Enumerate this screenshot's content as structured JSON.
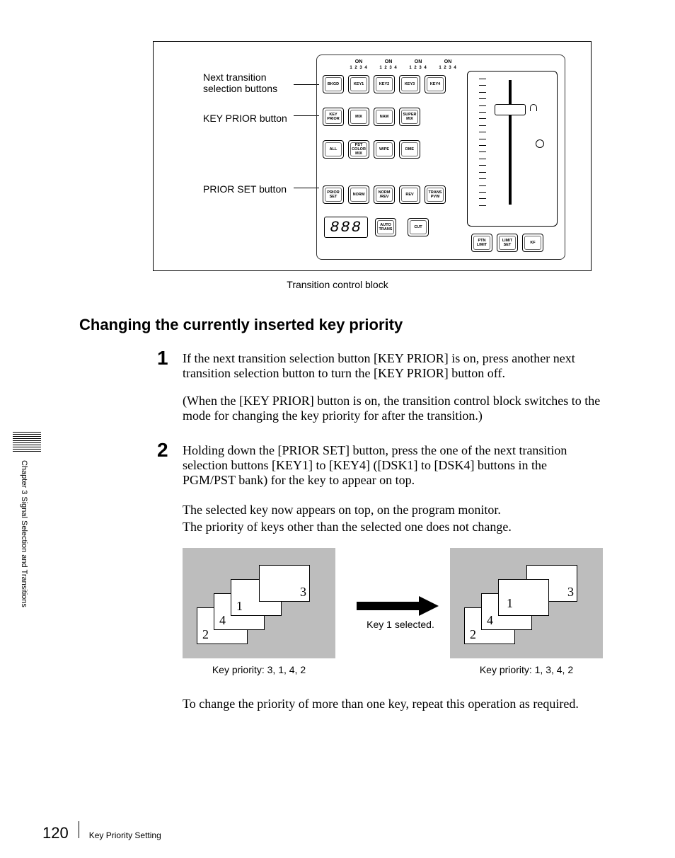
{
  "sidebar": {
    "chapter": "Chapter 3  Signal Selection and Transitions"
  },
  "diagram": {
    "labels": {
      "next_transition": "Next transition",
      "selection_buttons": "selection buttons",
      "key_prior_button": "KEY PRIOR button",
      "prior_set_button": "PRIOR SET button"
    },
    "on_header": [
      "ON",
      "ON",
      "ON",
      "ON"
    ],
    "num_header": [
      "1 2 3 4",
      "1 2 3 4",
      "1 2 3 4",
      "1 2 3 4"
    ],
    "rows": [
      [
        "BKGD",
        "KEY1",
        "KEY2",
        "KEY3",
        "KEY4"
      ],
      [
        "KEY PRIOR",
        "MIX",
        "NAM",
        "SUPER MIX"
      ],
      [
        "ALL",
        "PST COLOR MIX",
        "WIPE",
        "DME"
      ],
      [
        "PRIOR SET",
        "NORM",
        "NORM /REV",
        "REV",
        "TRANS PVW"
      ]
    ],
    "bottom_row": {
      "display": "888",
      "buttons": [
        "AUTO TRANS",
        "CUT"
      ]
    },
    "fader_buttons": [
      "PTN LIMIT",
      "LIMIT SET",
      "KF"
    ],
    "caption": "Transition control block"
  },
  "heading": "Changing the currently inserted key priority",
  "steps": {
    "s1": {
      "num": "1",
      "p1": "If the next transition selection button [KEY PRIOR] is on, press another next transition selection button to turn the [KEY PRIOR] button off.",
      "p2": "(When the [KEY PRIOR] button is on, the transition control block switches to the mode for changing the key priority for after the transition.)"
    },
    "s2": {
      "num": "2",
      "p1": "Holding down the [PRIOR SET] button, press the one of the next transition selection buttons [KEY1] to [KEY4] ([DSK1] to [DSK4] buttons in the PGM/PST bank) for the key to appear on top.",
      "p2": "The selected key now appears on top, on the program monitor.",
      "p3": "The priority of keys other than the selected one does not change."
    }
  },
  "priority": {
    "left": {
      "labels": [
        "1",
        "2",
        "3",
        "4"
      ],
      "caption": "Key priority: 3, 1, 4, 2"
    },
    "arrow_label": "Key 1 selected.",
    "right": {
      "labels": [
        "1",
        "2",
        "3",
        "4"
      ],
      "caption": "Key priority: 1, 3, 4, 2"
    }
  },
  "closing": "To change the priority of more than one key, repeat this operation as required.",
  "footer": {
    "page": "120",
    "section": "Key Priority Setting"
  }
}
